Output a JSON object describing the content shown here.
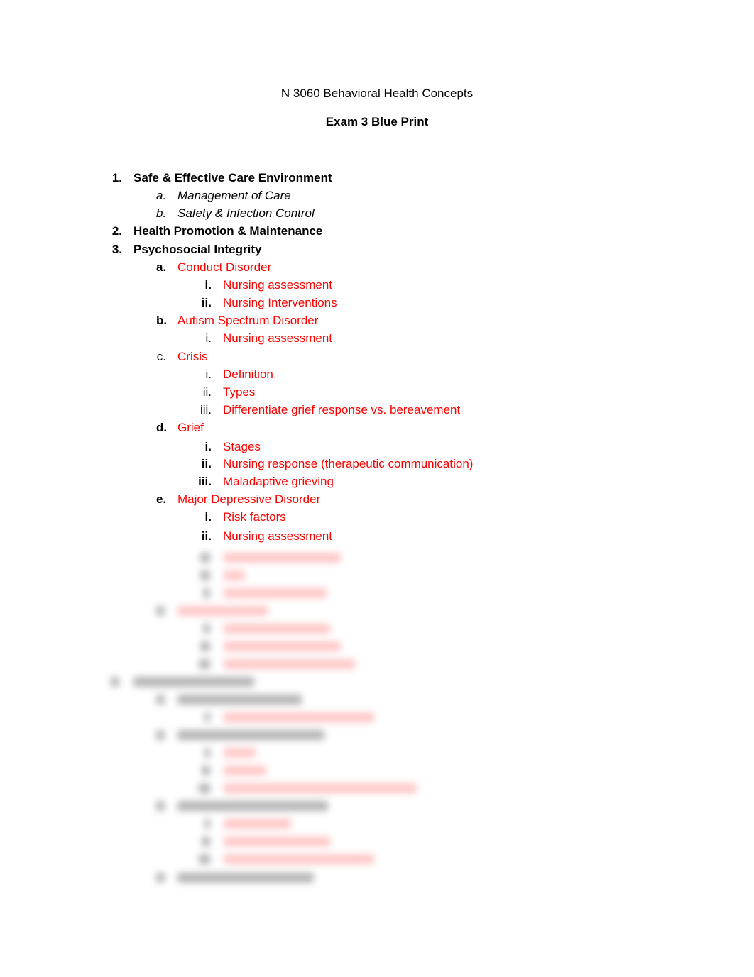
{
  "document": {
    "course_title": "N 3060 Behavioral Health Concepts",
    "exam_title": "Exam 3 Blue Print"
  },
  "outline": {
    "s1": {
      "num": "1.",
      "label": "Safe & Effective Care Environment",
      "a": {
        "num": "a.",
        "label": "Management of Care"
      },
      "b": {
        "num": "b.",
        "label": "Safety & Infection Control"
      }
    },
    "s2": {
      "num": "2.",
      "label": "Health Promotion & Maintenance"
    },
    "s3": {
      "num": "3.",
      "label": "Psychosocial Integrity",
      "a": {
        "num": "a.",
        "label": "Conduct Disorder",
        "i": {
          "num": "i.",
          "label": "Nursing assessment"
        },
        "ii": {
          "num": "ii.",
          "label": "Nursing Interventions"
        }
      },
      "b": {
        "num": "b.",
        "label": "Autism Spectrum Disorder",
        "i": {
          "num": "i.",
          "label": "Nursing assessment"
        }
      },
      "c": {
        "num": "c.",
        "label": "Crisis",
        "i": {
          "num": "i.",
          "label": "Definition"
        },
        "ii": {
          "num": "ii.",
          "label": "Types"
        },
        "iii": {
          "num": "iii.",
          "label": "Differentiate grief response vs. bereavement"
        }
      },
      "d": {
        "num": "d.",
        "label": "Grief",
        "i": {
          "num": "i.",
          "label": "Stages"
        },
        "ii": {
          "num": "ii.",
          "label": "Nursing response (therapeutic communication)"
        },
        "iii": {
          "num": "iii.",
          "label": "Maladaptive grieving"
        }
      },
      "e": {
        "num": "e.",
        "label": "Major Depressive Disorder",
        "i": {
          "num": "i.",
          "label": "Risk factors"
        },
        "ii": {
          "num": "ii.",
          "label": "Nursing assessment"
        }
      }
    }
  },
  "colors": {
    "highlight_red": "#ff0000",
    "text_black": "#000000"
  }
}
